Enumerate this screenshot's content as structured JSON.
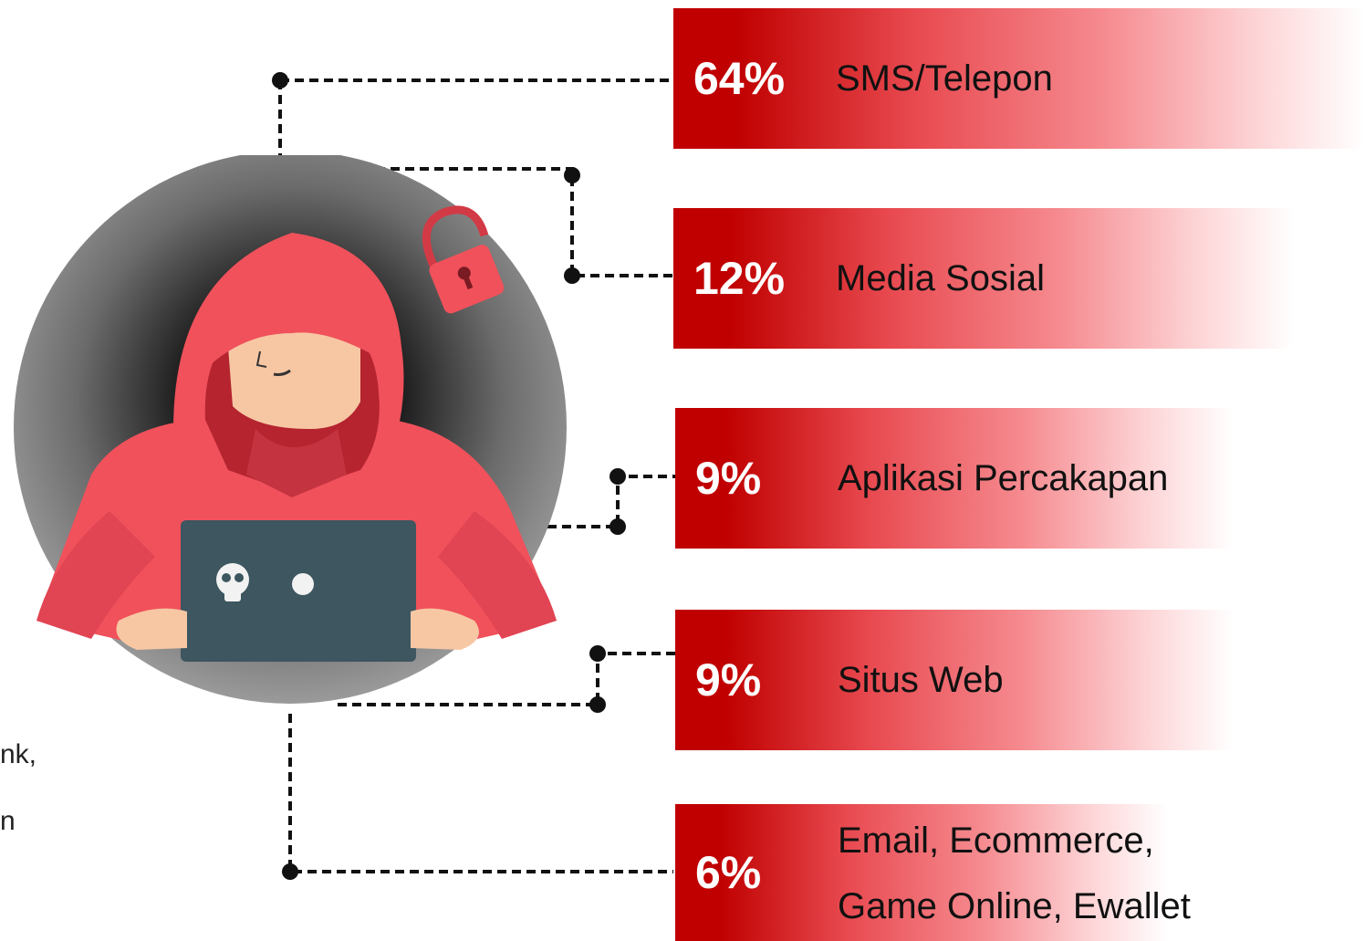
{
  "channels": [
    {
      "percent": "64%",
      "label": "SMS/Telepon"
    },
    {
      "percent": "12%",
      "label": "Media Sosial"
    },
    {
      "percent": "9%",
      "label": "Aplikasi Percakapan"
    },
    {
      "percent": "9%",
      "label": "Situs Web"
    },
    {
      "percent": "6%",
      "label_line1": "Email, Ecommerce,",
      "label_line2": "Game Online, Ewallet"
    }
  ],
  "side_text": {
    "line1": "nk,",
    "line2": "n"
  },
  "colors": {
    "bar_start": "#c00000",
    "bar_end": "#ffffff",
    "hood": "#f0515b",
    "laptop": "#3d5660",
    "circle": "#8a8a8a"
  },
  "illustration": {
    "icons": [
      "hacker-hood",
      "laptop",
      "skull-icon",
      "padlock-icon"
    ]
  }
}
